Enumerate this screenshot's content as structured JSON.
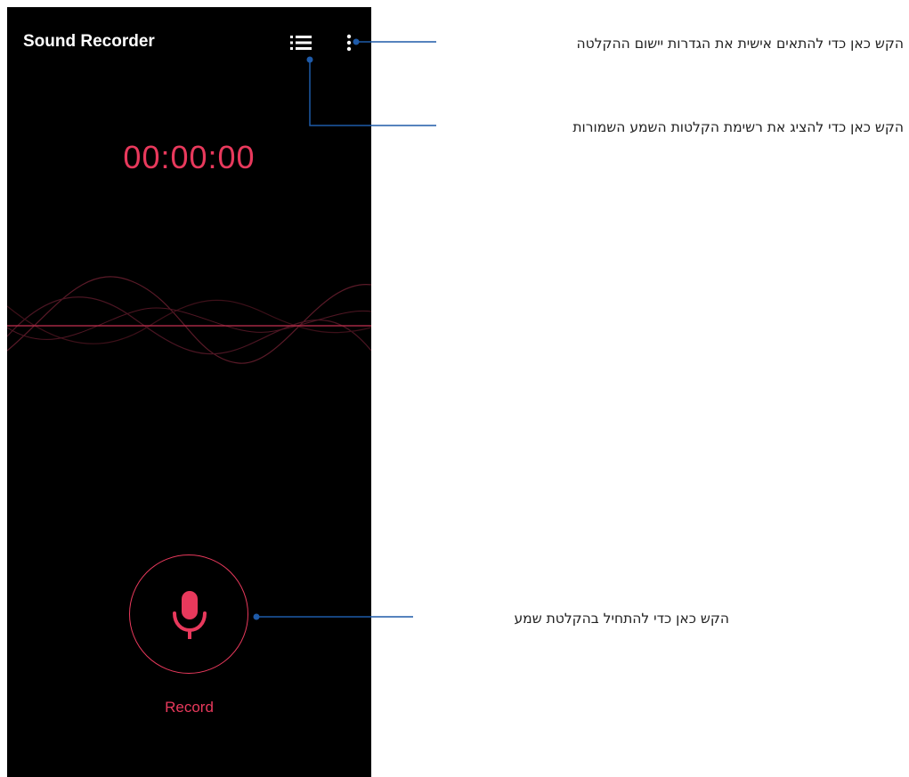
{
  "app": {
    "title": "Sound Recorder",
    "timer": "00:00:00",
    "record_label": "Record"
  },
  "toolbar": {
    "list_icon": "list-icon",
    "more_icon": "more-vert-icon"
  },
  "record_button": {
    "icon": "mic-icon"
  },
  "annotations": {
    "settings": "הקש כאן כדי להתאים אישית את הגדרות יישום ההקלטה",
    "list": "הקש כאן כדי להציג את רשימת הקלטות השמע השמורות",
    "record": "הקש כאן כדי להתחיל בהקלטת שמע"
  },
  "colors": {
    "accent": "#e8395c",
    "background": "#000000",
    "callout_line": "#1e5aa8"
  }
}
